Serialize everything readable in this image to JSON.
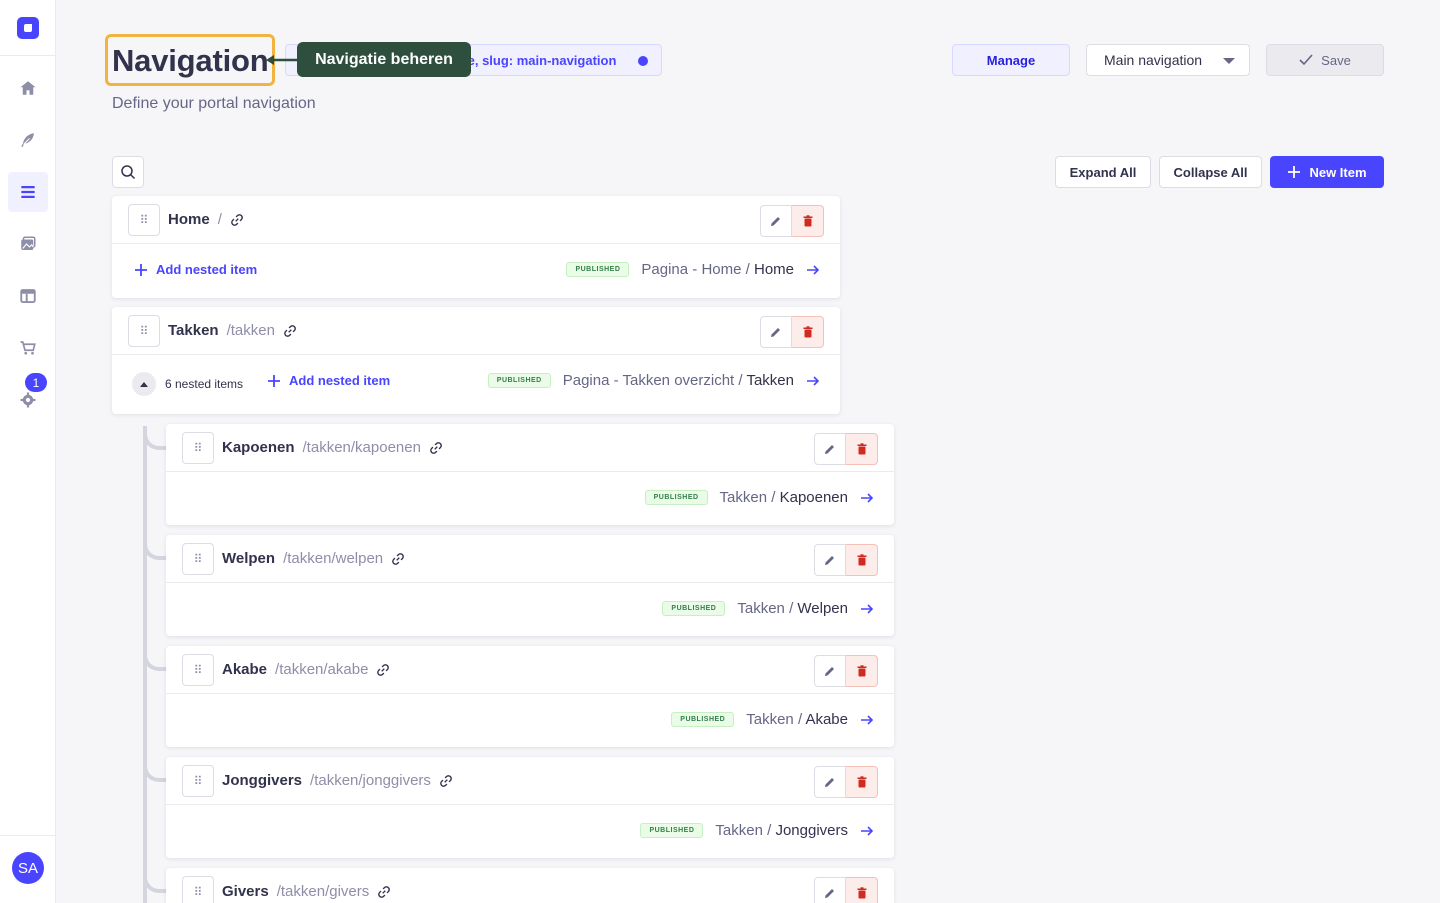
{
  "sidebar": {
    "items": [
      {
        "name": "home-icon",
        "active": false
      },
      {
        "name": "feather-icon",
        "active": false
      },
      {
        "name": "list-icon",
        "active": true
      },
      {
        "name": "media-icon",
        "active": false
      },
      {
        "name": "layout-icon",
        "active": false
      },
      {
        "name": "cart-icon",
        "active": false
      },
      {
        "name": "gear-icon",
        "active": false
      }
    ],
    "settings_badge": "1",
    "user_initials": "SA"
  },
  "header": {
    "title": "Navigation",
    "info_chip_text": "ie, slug: main-navigation",
    "callout": "Navigatie beheren",
    "subtitle": "Define your portal navigation",
    "manage_label": "Manage",
    "selected_navigation": "Main navigation",
    "save_label": "Save"
  },
  "toolbar": {
    "expand_all": "Expand All",
    "collapse_all": "Collapse All",
    "new_item": "New Item"
  },
  "labels": {
    "add_nested_item": "Add nested item",
    "published": "PUBLISHED",
    "nested_count": "6 nested items",
    "separator": "/"
  },
  "items": [
    {
      "title": "Home",
      "path": "/",
      "target_prefix": "Pagina - Home",
      "target_name": "Home"
    },
    {
      "title": "Takken",
      "path": "/takken",
      "target_prefix": "Pagina - Takken overzicht",
      "target_name": "Takken"
    }
  ],
  "nested_items": [
    {
      "title": "Kapoenen",
      "path": "/takken/kapoenen",
      "target_prefix": "Takken",
      "target_name": "Kapoenen"
    },
    {
      "title": "Welpen",
      "path": "/takken/welpen",
      "target_prefix": "Takken",
      "target_name": "Welpen"
    },
    {
      "title": "Akabe",
      "path": "/takken/akabe",
      "target_prefix": "Takken",
      "target_name": "Akabe"
    },
    {
      "title": "Jonggivers",
      "path": "/takken/jonggivers",
      "target_prefix": "Takken",
      "target_name": "Jonggivers"
    },
    {
      "title": "Givers",
      "path": "/takken/givers",
      "target_prefix": "",
      "target_name": ""
    }
  ],
  "colors": {
    "primary": "#4945ff",
    "highlight_border": "#f2b441",
    "callout_bg": "#2f4f3e",
    "danger": "#d02b20",
    "success": "#328048"
  }
}
